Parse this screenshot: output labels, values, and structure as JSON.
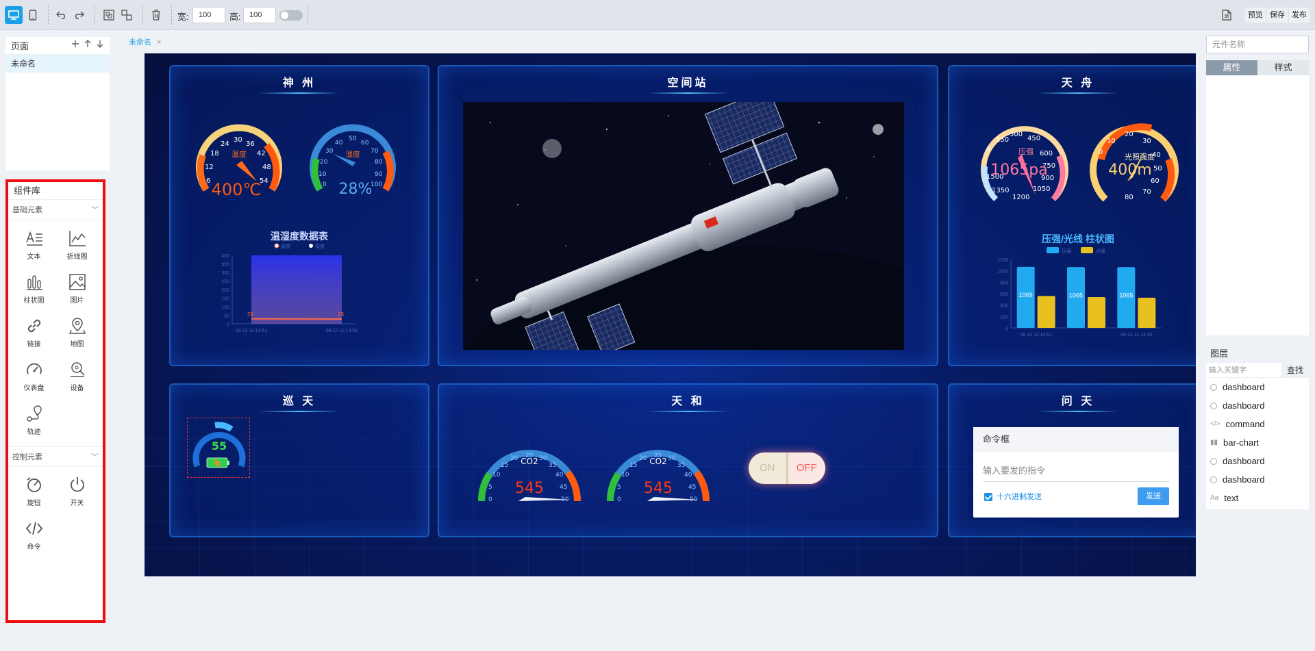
{
  "toolbar": {
    "width_label": "宽:",
    "width_value": "100",
    "height_label": "高:",
    "height_value": "100",
    "preview": "预览",
    "save": "保存",
    "publish": "发布"
  },
  "pages_panel": {
    "title": "页面",
    "items": [
      "未命名"
    ]
  },
  "component_library": {
    "title": "组件库",
    "basic_section": "基础元素",
    "basic_items": [
      {
        "label": "文本",
        "icon": "text-icon"
      },
      {
        "label": "折线图",
        "icon": "line-chart-icon"
      },
      {
        "label": "柱状图",
        "icon": "bar-chart-icon"
      },
      {
        "label": "图片",
        "icon": "image-icon"
      },
      {
        "label": "链接",
        "icon": "link-icon"
      },
      {
        "label": "地图",
        "icon": "map-pin-icon"
      },
      {
        "label": "仪表盘",
        "icon": "gauge-icon"
      },
      {
        "label": "设备",
        "icon": "device-icon"
      },
      {
        "label": "轨迹",
        "icon": "route-icon"
      }
    ],
    "control_section": "控制元素",
    "control_items": [
      {
        "label": "旋钮",
        "icon": "knob-icon"
      },
      {
        "label": "开关",
        "icon": "power-icon"
      },
      {
        "label": "命令",
        "icon": "code-icon"
      }
    ]
  },
  "editor_tab": {
    "label": "未命名",
    "close": "×"
  },
  "dashboard": {
    "panels": {
      "shenzhou": "神 州",
      "station": "空间站",
      "tianzhou": "天 舟",
      "xuntian": "巡 天",
      "tianhe": "天 和",
      "wentian": "问 天"
    },
    "shenzhou": {
      "temp_gauge": {
        "label": "温度",
        "value": "400℃",
        "ticks": [
          "6",
          "12",
          "18",
          "24",
          "30",
          "36",
          "42",
          "48",
          "54"
        ],
        "percent": 0.62
      },
      "humid_gauge": {
        "label": "湿度",
        "value": "28%",
        "ticks": [
          "0",
          "10",
          "20",
          "30",
          "40",
          "50",
          "60",
          "70",
          "80",
          "90",
          "100"
        ],
        "percent": 0.28
      },
      "chart_title": "温湿度数据表"
    },
    "tianzhou": {
      "pressure_gauge": {
        "label": "压强",
        "value": "1065pa",
        "ticks": [
          "0",
          "150",
          "300",
          "450",
          "600",
          "750",
          "900",
          "1050",
          "1200",
          "1350",
          "1500"
        ],
        "percent": 0.71
      },
      "light_gauge": {
        "label": "光照强度",
        "value": "400m",
        "ticks": [
          "0",
          "10",
          "20",
          "30",
          "40",
          "50",
          "60",
          "70",
          "80"
        ],
        "percent": 0.3
      },
      "chart_title": "压强/光线 柱状图"
    },
    "xuntian": {
      "ring_value": "55"
    },
    "tianhe": {
      "co2_gauges": [
        {
          "label": "CO2",
          "value": "545",
          "ticks": [
            "0",
            "5",
            "10",
            "15",
            "20",
            "25",
            "30",
            "35",
            "40",
            "45",
            "50"
          ]
        },
        {
          "label": "CO2",
          "value": "545",
          "ticks": [
            "0",
            "5",
            "10",
            "15",
            "20",
            "25",
            "30",
            "35",
            "40",
            "45",
            "50"
          ]
        }
      ],
      "switch_on": "ON",
      "switch_off": "OFF"
    },
    "command_box": {
      "title": "命令框",
      "placeholder": "输入要发的指令",
      "hex_label": "十六进制发送",
      "send": "发送"
    }
  },
  "chart_data": [
    {
      "type": "area",
      "title": "温湿度数据表",
      "series": [
        {
          "name": "温度",
          "values": [
            400,
            400
          ]
        },
        {
          "name": "湿度",
          "values": [
            29,
            28
          ]
        }
      ],
      "x": [
        "08-12 11:14:51",
        "08-12 11:14:56"
      ],
      "ylim": [
        0,
        400
      ],
      "yticks": [
        "0",
        "50",
        "100",
        "150",
        "200",
        "250",
        "300",
        "350",
        "400"
      ],
      "data_labels": [
        "29",
        "28"
      ]
    },
    {
      "type": "bar",
      "title": "压强/光线 柱状图",
      "categories": [
        "08-12 11:14:51",
        "",
        "08-12 11:14:56"
      ],
      "series": [
        {
          "name": "压强",
          "values": [
            1069,
            1065,
            1065
          ]
        },
        {
          "name": "光强",
          "values": [
            560,
            540,
            530
          ]
        }
      ],
      "ylim": [
        0,
        1200
      ],
      "yticks": [
        "0",
        "200",
        "400",
        "600",
        "800",
        "1000",
        "1200"
      ],
      "colors": [
        "#22aaf0",
        "#e8c020"
      ]
    }
  ],
  "properties_panel": {
    "name_placeholder": "元件名称",
    "tab_props": "属性",
    "tab_style": "样式"
  },
  "layers_panel": {
    "title": "图层",
    "search_placeholder": "输入关键字",
    "search_button": "查找",
    "items": [
      "dashboard",
      "dashboard",
      "command",
      "bar-chart",
      "dashboard",
      "dashboard",
      "text"
    ]
  }
}
